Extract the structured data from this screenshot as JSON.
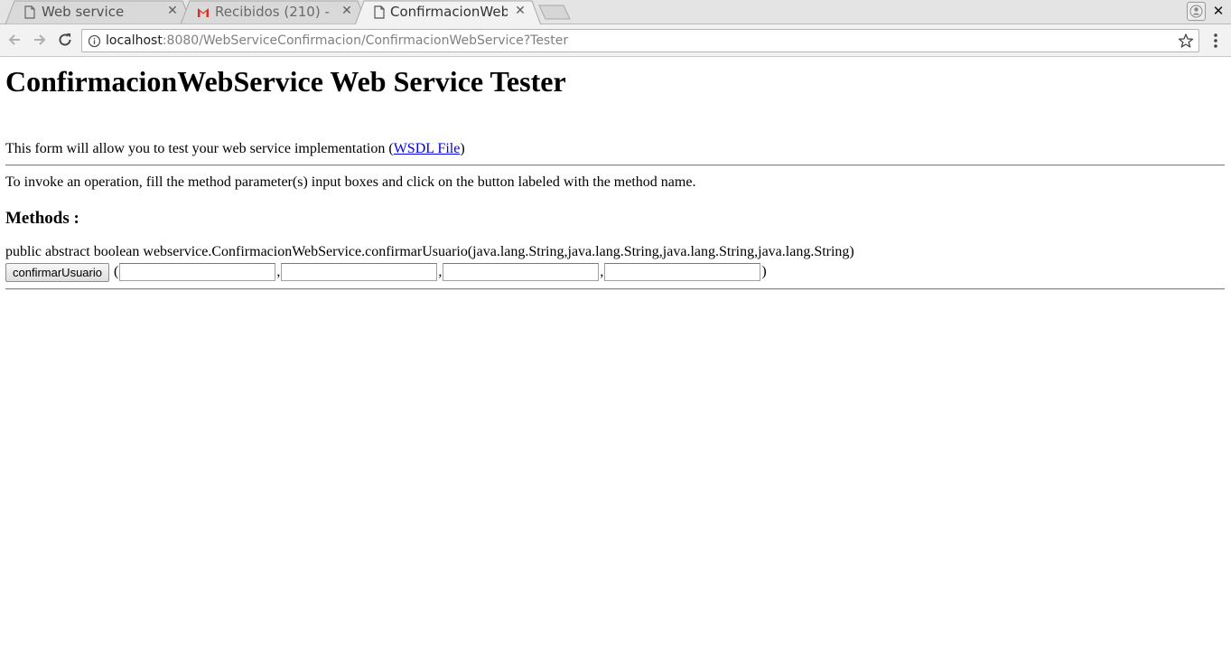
{
  "browser": {
    "tabs": [
      {
        "title": "Web service",
        "icon": "page-icon",
        "active": false
      },
      {
        "title": "Recibidos (210) -",
        "icon": "gmail-icon",
        "active": false
      },
      {
        "title": "ConfirmacionWeb",
        "icon": "page-icon",
        "active": true
      }
    ],
    "url_host": "localhost",
    "url_rest": ":8080/WebServiceConfirmacion/ConfirmacionWebService?Tester"
  },
  "page": {
    "title": "ConfirmacionWebService Web Service Tester",
    "intro_text": "This form will allow you to test your web service implementation (",
    "intro_link": "WSDL File",
    "intro_close": ")",
    "instructions": "To invoke an operation, fill the method parameter(s) input boxes and click on the button labeled with the method name.",
    "methods_heading": "Methods :",
    "method": {
      "signature": "public abstract boolean webservice.ConfirmacionWebService.confirmarUsuario(java.lang.String,java.lang.String,java.lang.String,java.lang.String)",
      "button_label": "confirmarUsuario",
      "open_paren": "(",
      "separator": ",",
      "close_paren": ")",
      "params": [
        "",
        "",
        "",
        ""
      ]
    }
  }
}
